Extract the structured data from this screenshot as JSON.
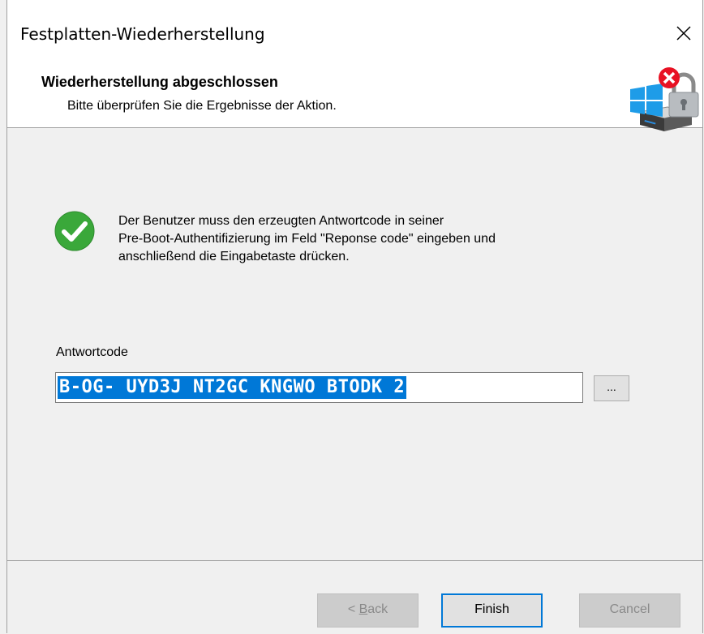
{
  "window": {
    "title": "Festplatten-Wiederherstellung"
  },
  "header": {
    "title": "Wiederherstellung abgeschlossen",
    "subtitle": "Bitte überprüfen Sie die Ergebnisse der Aktion."
  },
  "content": {
    "message_line1": "Der Benutzer muss den erzeugten Antwortcode in seiner",
    "message_line2": "Pre-Boot-Authentifizierung im Feld \"Reponse code\" eingeben und",
    "message_line3": "anschließend die Eingabetaste drücken.",
    "response_label": "Antwortcode",
    "response_code": "B-OG- UYD3J NT2GC KNGWO BTODK 2",
    "browse_label": "..."
  },
  "footer": {
    "back_prefix": "< ",
    "back_mnemonic": "B",
    "back_rest": "ack",
    "finish_label": "Finish",
    "cancel_label": "Cancel"
  },
  "colors": {
    "selection": "#0078d7",
    "success": "#3aa83a",
    "error": "#e81123"
  },
  "icons": {
    "close": "close-icon",
    "success": "success-check-icon",
    "header": "disk-lock-icon"
  }
}
